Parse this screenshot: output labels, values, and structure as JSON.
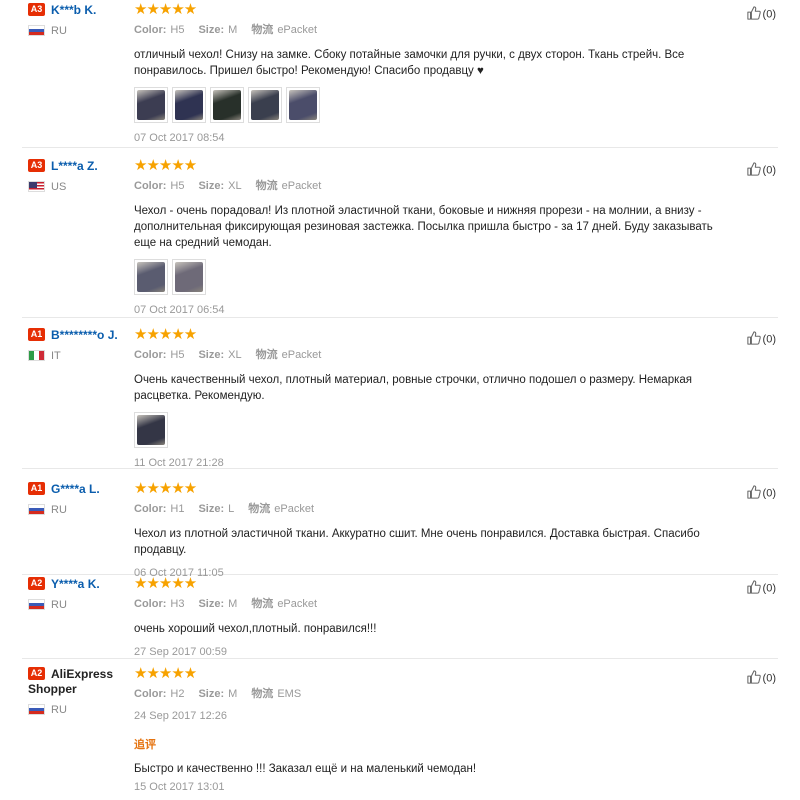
{
  "colors": {
    "star": "#f7a200",
    "username": "#0a5dad",
    "level_badge": "#e62e04",
    "feedback_label": "#e5730f"
  },
  "reviews": [
    {
      "level": "A3",
      "name": "K***b K.",
      "name_style": "link",
      "country": "RU",
      "flag": "ru",
      "rating": "★★★★★",
      "color_key": "Color:",
      "color": "H5",
      "size_key": "Size:",
      "size": "M",
      "ship_key": "物流",
      "ship": "ePacket",
      "text": "отличный чехол! Снизу на замке. Сбоку потайные замочки для ручки, с двух сторон. Ткань стрейч. Все понравилось. Пришел быстро! Рекомендую! Спасибо продавцу ♥",
      "photos": [
        "#3c3d52",
        "#2f3352",
        "#28302a",
        "#3a3f4e",
        "#4b4d6a"
      ],
      "date": "07 Oct 2017 08:54",
      "likes": "(0)"
    },
    {
      "level": "A3",
      "name": "L****a Z.",
      "name_style": "link",
      "country": "US",
      "flag": "us",
      "rating": "★★★★★",
      "color_key": "Color:",
      "color": "H5",
      "size_key": "Size:",
      "size": "XL",
      "ship_key": "物流",
      "ship": "ePacket",
      "text": "Чехол - очень порадовал! Из плотной эластичной ткани, боковые и нижняя прорези - на молнии, а внизу - дополнительная фиксирующая резиновая застежка. Посылка пришла быстро - за 17 дней. Буду заказывать еще на средний чемодан.",
      "photos": [
        "#5a5c70",
        "#6e6a78"
      ],
      "date": "07 Oct 2017 06:54",
      "likes": "(0)"
    },
    {
      "level": "A1",
      "name": "B********o J.",
      "name_style": "link",
      "country": "IT",
      "flag": "it",
      "rating": "★★★★★",
      "color_key": "Color:",
      "color": "H5",
      "size_key": "Size:",
      "size": "XL",
      "ship_key": "物流",
      "ship": "ePacket",
      "text": "Очень качественный чехол, плотный материал, ровные строчки, отлично подошел о размеру. Немаркая расцветка. Рекомендую.",
      "photos": [
        "#343646"
      ],
      "date": "11 Oct 2017 21:28",
      "likes": "(0)"
    },
    {
      "level": "A1",
      "name": "G****a L.",
      "name_style": "link",
      "country": "RU",
      "flag": "ru",
      "rating": "★★★★★",
      "color_key": "Color:",
      "color": "H1",
      "size_key": "Size:",
      "size": "L",
      "ship_key": "物流",
      "ship": "ePacket",
      "text": "Чехол из плотной эластичной ткани. Аккуратно сшит. Мне очень понравился. Доставка быстрая. Спасибо продавцу.",
      "photos": [],
      "date": "06 Oct 2017 11:05",
      "likes": "(0)"
    },
    {
      "level": "A2",
      "name": "Y****a K.",
      "name_style": "link",
      "country": "RU",
      "flag": "ru",
      "rating": "★★★★★",
      "color_key": "Color:",
      "color": "H3",
      "size_key": "Size:",
      "size": "M",
      "ship_key": "物流",
      "ship": "ePacket",
      "text": "очень хороший чехол,плотный. понравился!!!",
      "photos": [],
      "date": "27 Sep 2017 00:59",
      "likes": "(0)"
    },
    {
      "level": "A2",
      "name": "AliExpress Shopper",
      "name_style": "dark",
      "country": "RU",
      "flag": "ru",
      "rating": "★★★★★",
      "color_key": "Color:",
      "color": "H2",
      "size_key": "Size:",
      "size": "M",
      "ship_key": "物流",
      "ship": "EMS",
      "text": "",
      "photos": [],
      "date": "24 Sep 2017 12:26",
      "likes": "(0)",
      "additional_label": "追评",
      "additional_text": "Быстро и качественно !!! Заказал ещё и на маленький чемодан!",
      "additional_date": "15 Oct 2017 13:01"
    }
  ]
}
